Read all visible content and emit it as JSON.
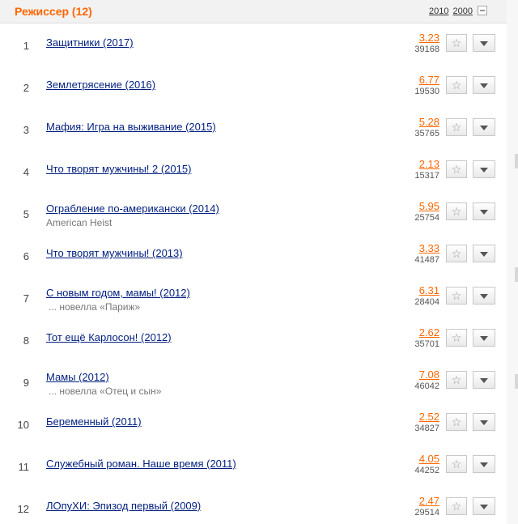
{
  "section": {
    "title": "Режиссер (12)",
    "decades": [
      "2010",
      "2000"
    ]
  },
  "icons": {
    "star": "star-icon",
    "dropdown": "chevron-down-icon",
    "collapse": "minus-box-icon"
  },
  "colors": {
    "accent": "#ff6600",
    "link": "#001f7f"
  },
  "films": [
    {
      "num": "1",
      "title": "Защитники (2017)",
      "sub": "",
      "rating": "3.23",
      "votes": "39168"
    },
    {
      "num": "2",
      "title": "Землетрясение (2016)",
      "sub": "",
      "rating": "6.77",
      "votes": "19530"
    },
    {
      "num": "3",
      "title": "Мафия: Игра на выживание (2015)",
      "sub": "",
      "rating": "5.28",
      "votes": "35765"
    },
    {
      "num": "4",
      "title": "Что творят мужчины! 2 (2015)",
      "sub": "",
      "rating": "2.13",
      "votes": "15317"
    },
    {
      "num": "5",
      "title": "Ограбление по-американски (2014)",
      "sub": "American Heist",
      "rating": "5.95",
      "votes": "25754"
    },
    {
      "num": "6",
      "title": "Что творят мужчины! (2013)",
      "sub": "",
      "rating": "3.33",
      "votes": "41487"
    },
    {
      "num": "7",
      "title": "С новым годом, мамы! (2012)",
      "sub": "... новелла «Париж»",
      "rating": "6.31",
      "votes": "28404"
    },
    {
      "num": "8",
      "title": "Тот ещё Карлосон! (2012)",
      "sub": "",
      "rating": "2.62",
      "votes": "35701"
    },
    {
      "num": "9",
      "title": "Мамы (2012)",
      "sub": "... новелла «Отец и сын»",
      "rating": "7.08",
      "votes": "46042"
    },
    {
      "num": "10",
      "title": "Беременный (2011)",
      "sub": "",
      "rating": "2.52",
      "votes": "34827"
    },
    {
      "num": "11",
      "title": "Служебный роман. Наше время (2011)",
      "sub": "",
      "rating": "4.05",
      "votes": "44252"
    },
    {
      "num": "12",
      "title": "ЛОпуХИ: Эпизод первый (2009)",
      "sub": "",
      "rating": "2.47",
      "votes": "29514"
    }
  ]
}
